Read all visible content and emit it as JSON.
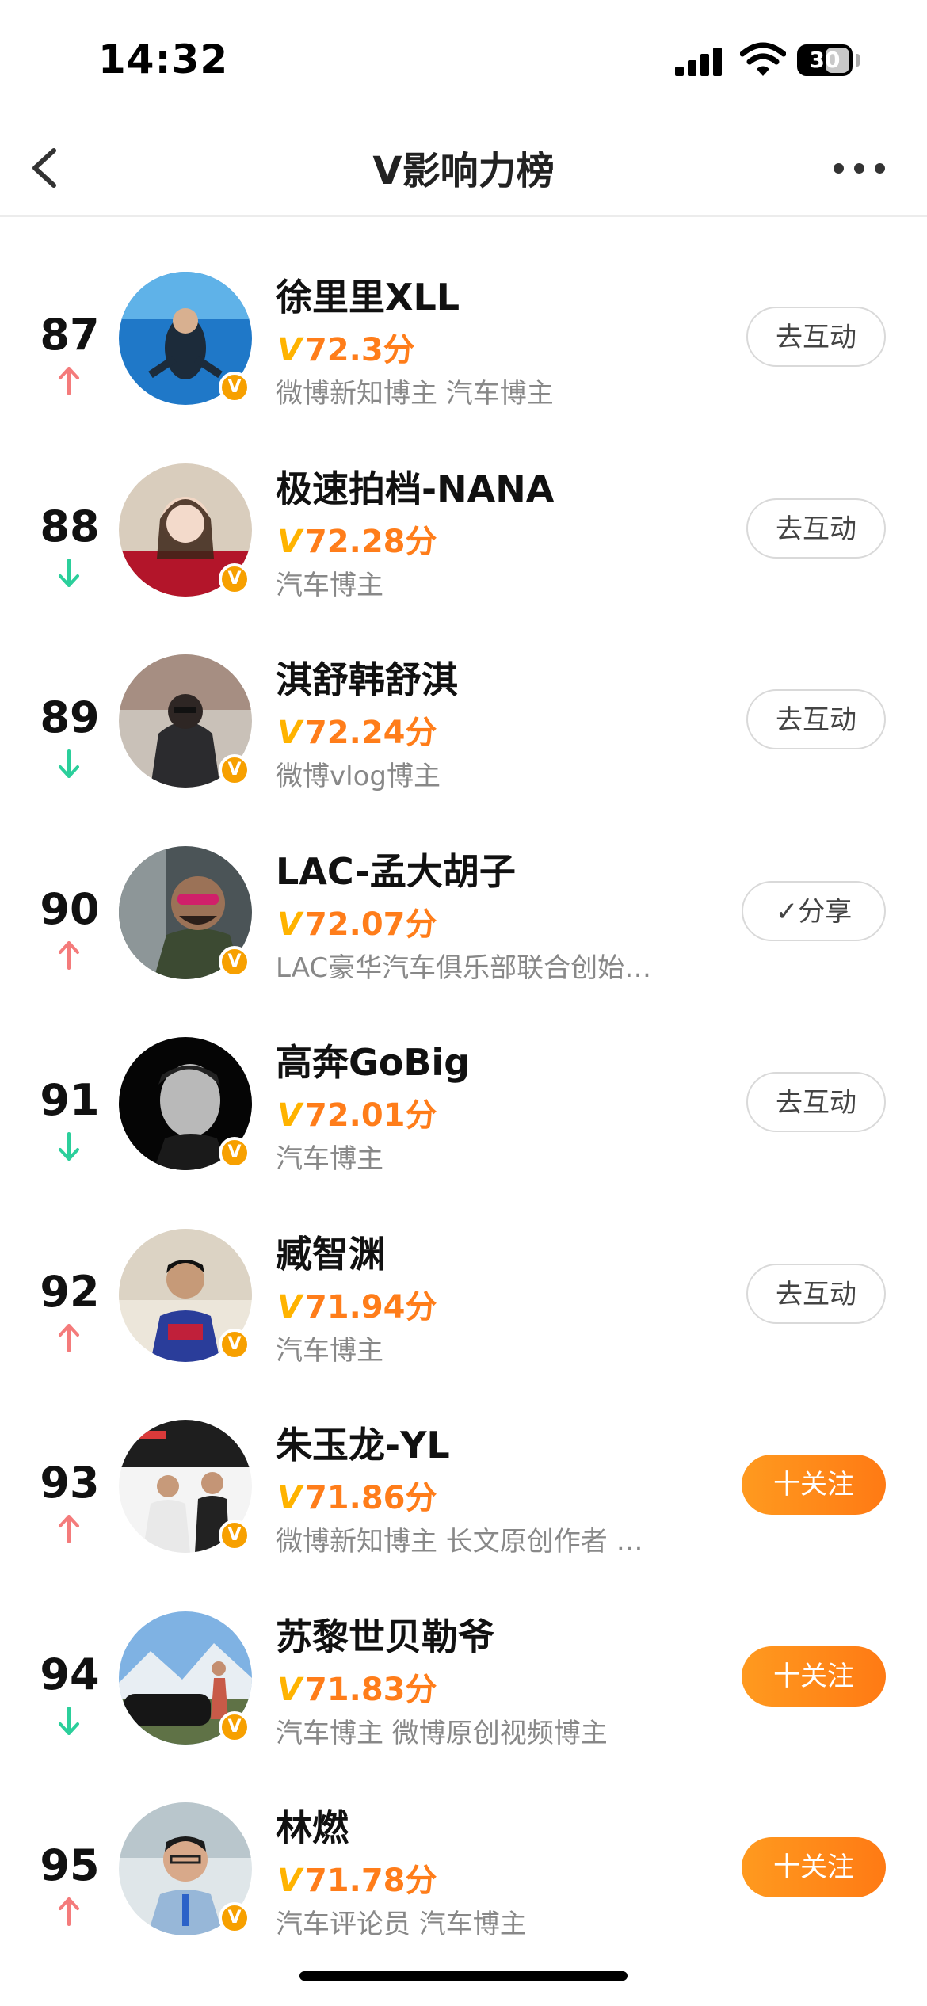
{
  "status_bar": {
    "time": "14:32",
    "battery": "30"
  },
  "nav": {
    "title": "V影响力榜"
  },
  "colors": {
    "score": "#ff7d1a",
    "up": "#f47b7b",
    "down": "#2bcf9b",
    "badge": "#f7a000",
    "follow": "#ff8a1a"
  },
  "rows": [
    {
      "rank": "87",
      "trend": "up",
      "name": "徐里里XLL",
      "score_v": "V",
      "score": "72.3分",
      "tags": "微博新知博主 汽车博主",
      "action": "去互动",
      "action_type": "outline"
    },
    {
      "rank": "88",
      "trend": "down",
      "name": "极速拍档-NANA",
      "score_v": "V",
      "score": "72.28分",
      "tags": "汽车博主",
      "action": "去互动",
      "action_type": "outline"
    },
    {
      "rank": "89",
      "trend": "down",
      "name": "淇舒韩舒淇",
      "score_v": "V",
      "score": "72.24分",
      "tags": "微博vlog博主",
      "action": "去互动",
      "action_type": "outline"
    },
    {
      "rank": "90",
      "trend": "up",
      "name": "LAC-孟大胡子",
      "score_v": "V",
      "score": "72.07分",
      "tags": "LAC豪华汽车俱乐部联合创始…",
      "action": "✓分享",
      "action_type": "share"
    },
    {
      "rank": "91",
      "trend": "down",
      "name": "高奔GoBig",
      "score_v": "V",
      "score": "72.01分",
      "tags": "汽车博主",
      "action": "去互动",
      "action_type": "outline"
    },
    {
      "rank": "92",
      "trend": "up",
      "name": "臧智渊",
      "score_v": "V",
      "score": "71.94分",
      "tags": "汽车博主",
      "action": "去互动",
      "action_type": "outline"
    },
    {
      "rank": "93",
      "trend": "up",
      "name": "朱玉龙-YL",
      "score_v": "V",
      "score": "71.86分",
      "tags": "微博新知博主 长文原创作者 …",
      "action": "十关注",
      "action_type": "follow"
    },
    {
      "rank": "94",
      "trend": "down",
      "name": "苏黎世贝勒爷",
      "score_v": "V",
      "score": "71.83分",
      "tags": "汽车博主 微博原创视频博主",
      "action": "十关注",
      "action_type": "follow"
    },
    {
      "rank": "95",
      "trend": "up",
      "name": "林燃",
      "score_v": "V",
      "score": "71.78分",
      "tags": "汽车评论员 汽车博主",
      "action": "十关注",
      "action_type": "follow"
    }
  ]
}
